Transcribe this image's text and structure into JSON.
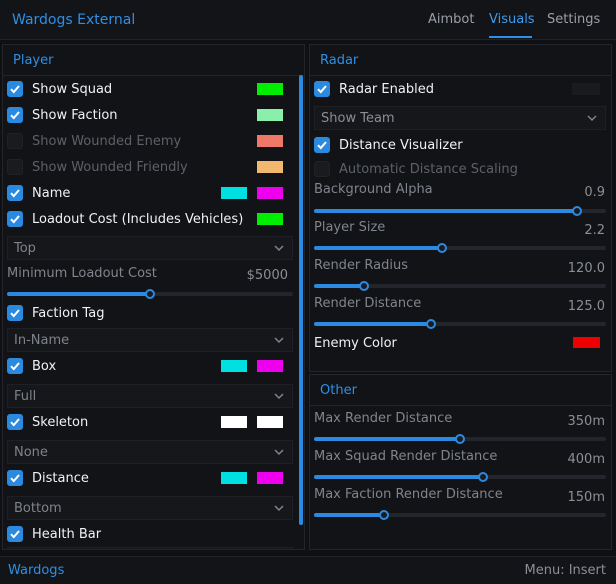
{
  "app_title": "Wardogs External",
  "tabs": [
    {
      "label": "Aimbot",
      "active": false
    },
    {
      "label": "Visuals",
      "active": true
    },
    {
      "label": "Settings",
      "active": false
    }
  ],
  "player": {
    "title": "Player",
    "show_squad": {
      "label": "Show Squad",
      "checked": true,
      "colors": [
        "#00ee00"
      ]
    },
    "show_faction": {
      "label": "Show Faction",
      "checked": true,
      "colors": [
        "#88f0a8"
      ]
    },
    "show_wounded_enemy": {
      "label": "Show Wounded Enemy",
      "checked": false,
      "colors": [
        "#f07868"
      ]
    },
    "show_wounded_friendly": {
      "label": "Show Wounded Friendly",
      "checked": false,
      "colors": [
        "#f2b870"
      ]
    },
    "name": {
      "label": "Name",
      "checked": true,
      "colors": [
        "#00e0e0",
        "#ee00ee"
      ]
    },
    "loadout_cost": {
      "label": "Loadout Cost (Includes Vehicles)",
      "checked": true,
      "colors": [
        "#00ee00"
      ]
    },
    "loadout_position": "Top",
    "min_loadout_cost": {
      "label": "Minimum Loadout Cost",
      "value_text": "$5000",
      "fraction": 0.5
    },
    "faction_tag": {
      "label": "Faction Tag",
      "checked": true
    },
    "faction_tag_mode": "In-Name",
    "box": {
      "label": "Box",
      "checked": true,
      "colors": [
        "#00e0e0",
        "#ee00ee"
      ]
    },
    "box_mode": "Full",
    "skeleton": {
      "label": "Skeleton",
      "checked": true,
      "colors": [
        "#ffffff",
        "#ffffff"
      ]
    },
    "skeleton_mode": "None",
    "distance": {
      "label": "Distance",
      "checked": true,
      "colors": [
        "#00e0e0",
        "#ee00ee"
      ]
    },
    "distance_position": "Bottom",
    "health_bar": {
      "label": "Health Bar",
      "checked": true
    }
  },
  "radar": {
    "title": "Radar",
    "radar_enabled": {
      "label": "Radar Enabled",
      "checked": true,
      "color": "#1a1b1f"
    },
    "team_mode": "Show Team",
    "distance_visualizer": {
      "label": "Distance Visualizer",
      "checked": true
    },
    "auto_distance_scaling": {
      "label": "Automatic Distance Scaling",
      "checked": false
    },
    "background_alpha": {
      "label": "Background Alpha",
      "value_text": "0.9",
      "fraction": 0.9
    },
    "player_size": {
      "label": "Player Size",
      "value_text": "2.2",
      "fraction": 0.44
    },
    "render_radius": {
      "label": "Render Radius",
      "value_text": "120.0",
      "fraction": 0.17
    },
    "render_distance": {
      "label": "Render Distance",
      "value_text": "125.0",
      "fraction": 0.4
    },
    "enemy_color": {
      "label": "Enemy Color",
      "color": "#ee0000"
    }
  },
  "other": {
    "title": "Other",
    "max_render_distance": {
      "label": "Max Render Distance",
      "value_text": "350m",
      "fraction": 0.5
    },
    "max_squad_render_distance": {
      "label": "Max Squad Render Distance",
      "value_text": "400m",
      "fraction": 0.58
    },
    "max_faction_render_distance": {
      "label": "Max Faction Render Distance",
      "value_text": "150m",
      "fraction": 0.24
    }
  },
  "footer": {
    "left": "Wardogs",
    "right": "Menu: Insert"
  }
}
